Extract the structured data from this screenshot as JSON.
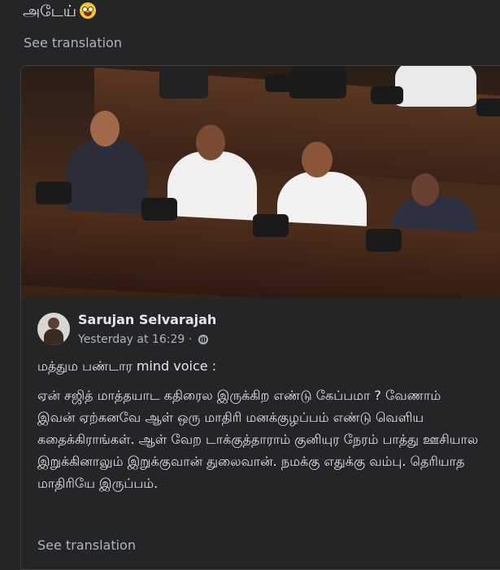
{
  "post": {
    "text": "அடேய்",
    "emoji": "grinning-squinting-face",
    "see_translation": "See translation"
  },
  "shared_post": {
    "photo_alt": "parliament-session-photo",
    "author": "Sarujan Selvarajah",
    "timestamp": "Yesterday at 16:29 ·",
    "privacy_icon": "globe-icon",
    "line1": "மத்தும பண்டார mind voice :",
    "body": "ஏன் சஜித் மாத்தயாட கதிரைல இருக்கிற எண்டு கேப்பமா ? வேணாம் இவன் ஏற்கனவே ஆள் ஒரு மாதிரி மனக்குழப்பம் எண்டு வெளிய கதைக்கிராங்கள். ஆள் வேற டாக்குத்தாராம் குனியுர நேரம் பாத்து ஊசியால இறுக்கினாலும் இறுக்குவான் துலைவான். நமக்கு எதுக்கு வம்பு. தெரியாத மாதிரியே இருப்பம்.",
    "see_translation": "See translation"
  }
}
